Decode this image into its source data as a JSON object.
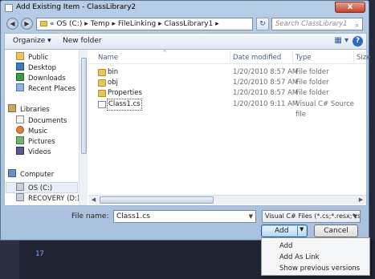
{
  "window": {
    "title": "Add Existing Item - ClassLibrary2",
    "close_label": "x"
  },
  "address": {
    "back_icon": "◀",
    "forward_icon": "▶",
    "path": "« OS (C:) ▸ Temp ▸ FileLinking ▸ ClassLibrary1 ▸",
    "refresh_icon": "↻",
    "search_placeholder": "Search ClassLibrary1",
    "search_icon": "⌕"
  },
  "toolbar": {
    "organize_label": "Organize ▾",
    "new_folder_label": "New folder",
    "views_icon": "▦ ▾",
    "help_icon": "?"
  },
  "nav": {
    "items": [
      {
        "label": "Public",
        "icon": "public-folder-icon"
      },
      {
        "label": "Desktop",
        "icon": "desktop-icon"
      },
      {
        "label": "Downloads",
        "icon": "downloads-icon"
      },
      {
        "label": "Recent Places",
        "icon": "recent-places-icon"
      },
      {
        "label": "Libraries",
        "icon": "libraries-icon"
      },
      {
        "label": "Documents",
        "icon": "documents-icon"
      },
      {
        "label": "Music",
        "icon": "music-icon"
      },
      {
        "label": "Pictures",
        "icon": "pictures-icon"
      },
      {
        "label": "Videos",
        "icon": "videos-icon"
      },
      {
        "label": "Computer",
        "icon": "computer-icon"
      },
      {
        "label": "OS (C:)",
        "icon": "drive-icon"
      },
      {
        "label": "RECOVERY (D:)",
        "icon": "drive-icon"
      }
    ]
  },
  "columns": {
    "name": "Name",
    "date": "Date modified",
    "type": "Type",
    "size": "Size"
  },
  "files": [
    {
      "name": "bin",
      "date": "1/20/2010 8:57 AM",
      "type": "File folder"
    },
    {
      "name": "obj",
      "date": "1/20/2010 8:57 AM",
      "type": "File folder"
    },
    {
      "name": "Properties",
      "date": "1/20/2010 8:57 AM",
      "type": "File folder"
    },
    {
      "name": "Class1.cs",
      "date": "1/20/2010 9:11 AM",
      "type": "Visual C# Source file"
    }
  ],
  "bottom": {
    "filename_label": "File name:",
    "filename_value": "Class1.cs",
    "filetype_value": "Visual C# Files (*.cs;*.resx;*.setti",
    "add_label": "Add",
    "add_arrow": "▼",
    "cancel_label": "Cancel",
    "dropdown_arrow": "▼"
  },
  "add_menu": [
    "Add",
    "Add As Link",
    "Show previous versions"
  ],
  "editor": {
    "line_number": "17"
  },
  "colors": {
    "dialog_chrome": "#b7cde6",
    "selection": "#e6eef8",
    "folder": "#e5c65a"
  }
}
